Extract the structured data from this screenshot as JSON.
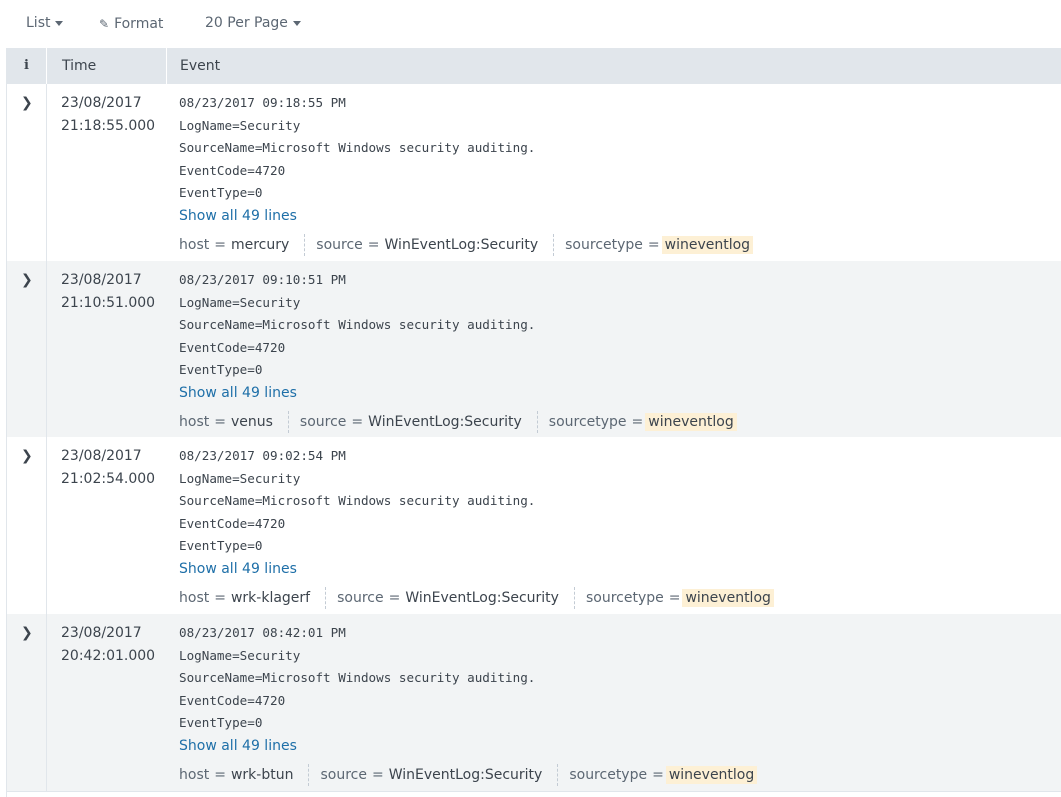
{
  "toolbar": {
    "list_label": "List",
    "format_label": "Format",
    "per_page_label": "20 Per Page"
  },
  "table": {
    "headers": {
      "info": "i",
      "time": "Time",
      "event": "Event"
    },
    "show_all_label": "Show all 49 lines",
    "rows": [
      {
        "date": "23/08/2017",
        "time": "21:18:55.000",
        "lines": [
          "08/23/2017 09:18:55 PM",
          "LogName=Security",
          "SourceName=Microsoft Windows security auditing.",
          "EventCode=4720",
          "EventType=0"
        ],
        "host_key": "host",
        "host": "mercury",
        "source_key": "source",
        "source": "WinEventLog:Security",
        "sourcetype_key": "sourcetype",
        "sourcetype": "wineventlog"
      },
      {
        "date": "23/08/2017",
        "time": "21:10:51.000",
        "lines": [
          "08/23/2017 09:10:51 PM",
          "LogName=Security",
          "SourceName=Microsoft Windows security auditing.",
          "EventCode=4720",
          "EventType=0"
        ],
        "host_key": "host",
        "host": "venus",
        "source_key": "source",
        "source": "WinEventLog:Security",
        "sourcetype_key": "sourcetype",
        "sourcetype": "wineventlog"
      },
      {
        "date": "23/08/2017",
        "time": "21:02:54.000",
        "lines": [
          "08/23/2017 09:02:54 PM",
          "LogName=Security",
          "SourceName=Microsoft Windows security auditing.",
          "EventCode=4720",
          "EventType=0"
        ],
        "host_key": "host",
        "host": "wrk-klagerf",
        "source_key": "source",
        "source": "WinEventLog:Security",
        "sourcetype_key": "sourcetype",
        "sourcetype": "wineventlog"
      },
      {
        "date": "23/08/2017",
        "time": "20:42:01.000",
        "lines": [
          "08/23/2017 08:42:01 PM",
          "LogName=Security",
          "SourceName=Microsoft Windows security auditing.",
          "EventCode=4720",
          "EventType=0"
        ],
        "host_key": "host",
        "host": "wrk-btun",
        "source_key": "source",
        "source": "WinEventLog:Security",
        "sourcetype_key": "sourcetype",
        "sourcetype": "wineventlog"
      }
    ]
  },
  "colors": {
    "header_bg": "#e1e6eb",
    "alt_row_bg": "#f2f4f5",
    "link": "#1e6fa8",
    "highlight": "#fdf0d5"
  }
}
